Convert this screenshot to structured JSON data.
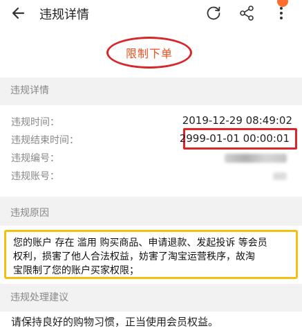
{
  "header": {
    "title": "违规详情",
    "back_icon": "arrow-left-icon",
    "refresh_icon": "refresh-icon",
    "share_icon": "share-icon",
    "more_icon": "more-vertical-icon",
    "badge_color": "#ff6d2d"
  },
  "banner": {
    "label": "限制下单",
    "label_color": "#f14f1d",
    "highlight_color": "#d8272a"
  },
  "details": {
    "section_title": "违规详情",
    "rows": [
      {
        "label": "违规时间：",
        "value": "2019-12-29 08:49:02"
      },
      {
        "label": "违规结束时间：",
        "value": "2999-01-01 00:00:01"
      },
      {
        "label": "违规编号：",
        "value": ""
      },
      {
        "label": "违规账号：",
        "value": ""
      }
    ]
  },
  "reason": {
    "section_title": "违规原因",
    "lines": [
      "您的账户 存在 滥用 购买商品、申请退款、发起投诉 等会员",
      "权利，损害了他人合法权益，妨害了淘宝运营秩序，故淘",
      "宝限制了您的账户买家权限；"
    ],
    "highlight_color": "#f3c011"
  },
  "advice": {
    "section_title": "违规处理建议",
    "text": "请保持良好的购物习惯，正当使用会员权益。"
  }
}
